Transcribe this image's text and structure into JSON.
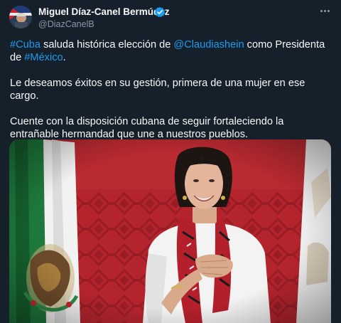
{
  "author": {
    "name": "Miguel Díaz-Canel Bermúdez",
    "handle": "@DiazCanelB",
    "verified_icon": "verified-badge-icon",
    "avatar_icon": "avatar-image"
  },
  "more_icon": "more-options-icon",
  "tweet": {
    "p1": {
      "hashtag1": "#Cuba",
      "text1": " saluda histórica elección de ",
      "mention": "@Claudiashein",
      "text2": " como Presidenta de ",
      "hashtag2": "#México",
      "text3": "."
    },
    "p2": "Le deseamos éxitos en su gestión, primera de una mujer en ese cargo.",
    "p3": "Cuente con la disposición cubana de seguir fortaleciendo la entrañable hermandad que une a nuestros pueblos."
  },
  "colors": {
    "background": "#15202b",
    "link": "#1d9bf0",
    "muted": "#8b98a5",
    "verified": "#1d9bf0",
    "photo_backdrop": "#b3242d"
  }
}
